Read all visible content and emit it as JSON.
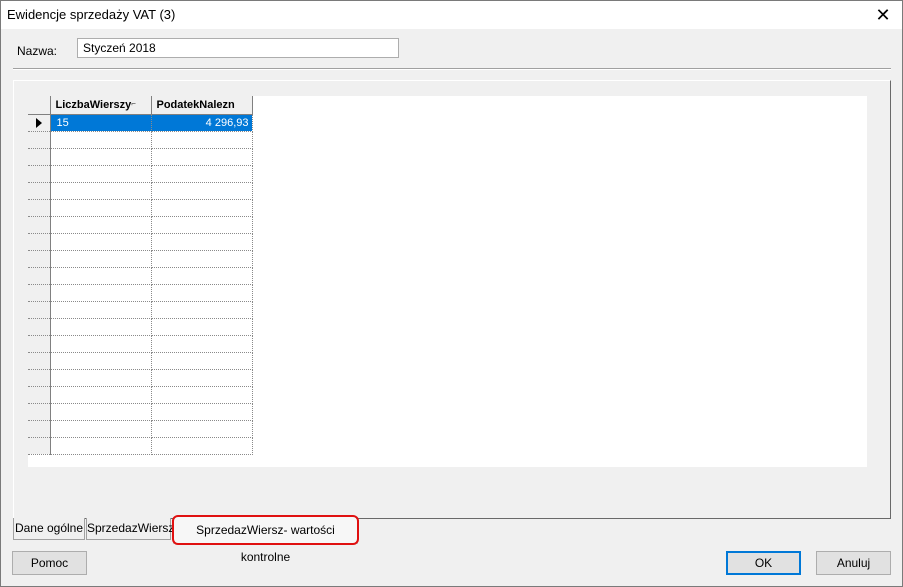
{
  "window": {
    "title": "Ewidencje sprzedaży VAT (3)"
  },
  "form": {
    "name_label": "Nazwa:",
    "name_value": "Styczeń 2018"
  },
  "grid": {
    "columns": [
      "LiczbaWierszy",
      "PodatekNalezn"
    ],
    "rows": [
      {
        "liczba": "15",
        "podatek": "4 296,93"
      }
    ]
  },
  "tabs": [
    {
      "label": "Dane ogólne"
    },
    {
      "label": "SprzedazWiersz"
    },
    {
      "label": "SprzedazWiersz- wartości kontrolne"
    }
  ],
  "buttons": {
    "help": "Pomoc",
    "ok": "OK",
    "cancel": "Anuluj"
  },
  "colors": {
    "selection": "#0078d7",
    "highlight": "#e01010"
  }
}
